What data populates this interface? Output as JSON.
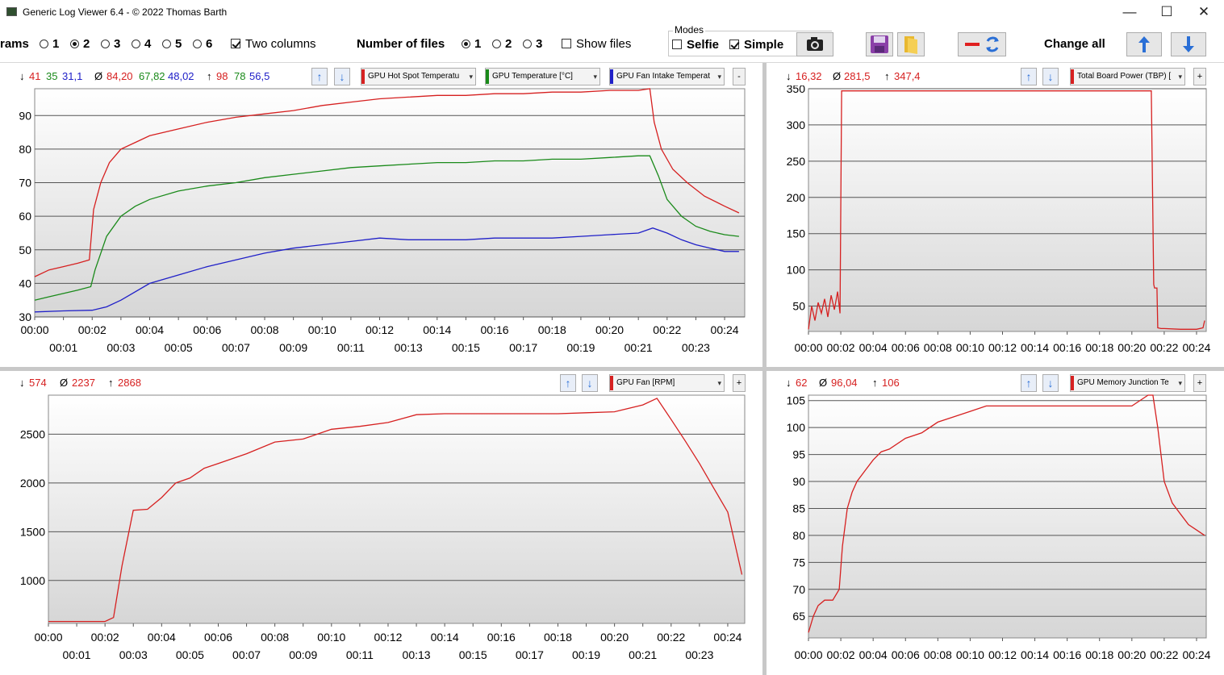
{
  "window": {
    "title": "Generic Log Viewer 6.4 - © 2022 Thomas Barth",
    "minimize": "—",
    "maximize": "☐",
    "close": "✕"
  },
  "toolbar": {
    "diagrams_label": "rams",
    "diagram_options": [
      "1",
      "2",
      "3",
      "4",
      "5",
      "6"
    ],
    "diagram_selected": "2",
    "two_columns_label": "Two columns",
    "two_columns_checked": true,
    "number_of_files_label": "Number of files",
    "file_options": [
      "1",
      "2",
      "3"
    ],
    "file_selected": "1",
    "show_files_label": "Show files",
    "show_files_checked": false,
    "modes_label": "Modes",
    "selfie_label": "Selfie",
    "selfie_checked": false,
    "simple_label": "Simple",
    "simple_checked": true,
    "change_all_label": "Change all",
    "icons": [
      "camera-icon",
      "save-icon",
      "folder-icon",
      "line-color-icon",
      "refresh-icon",
      "arrow-up-icon",
      "arrow-down-icon"
    ]
  },
  "panels": {
    "temps": {
      "min_values": [
        "41",
        "35",
        "31,1"
      ],
      "avg_values": [
        "84,20",
        "67,82",
        "48,02"
      ],
      "max_values": [
        "98",
        "78",
        "56,5"
      ],
      "stat_colors": [
        "#d62020",
        "#1a8a1a",
        "#2020c8"
      ],
      "selectors": [
        {
          "label": "GPU Hot Spot Temperatu",
          "color": "#d62020"
        },
        {
          "label": "GPU Temperature [°C]",
          "color": "#1a8a1a"
        },
        {
          "label": "GPU Fan Intake Temperat",
          "color": "#2020c8"
        }
      ],
      "extra_btn": "-"
    },
    "power": {
      "min_value": "16,32",
      "avg_value": "281,5",
      "max_value": "347,4",
      "selector": {
        "label": "Total Board Power (TBP) [",
        "color": "#d62020"
      },
      "extra_btn": "+"
    },
    "fan": {
      "min_value": "574",
      "avg_value": "2237",
      "max_value": "2868",
      "selector": {
        "label": "GPU Fan [RPM]",
        "color": "#d62020"
      },
      "extra_btn": "+"
    },
    "memjunc": {
      "min_value": "62",
      "avg_value": "96,04",
      "max_value": "106",
      "selector": {
        "label": "GPU Memory Junction Te",
        "color": "#d62020"
      },
      "extra_btn": "+"
    }
  },
  "symbols": {
    "min": "↓",
    "avg": "Ø",
    "max": "↑"
  },
  "chart_data": [
    {
      "id": "temps",
      "type": "line",
      "ylim": [
        30,
        98
      ],
      "yticks": [
        30,
        40,
        50,
        60,
        70,
        80,
        90
      ],
      "xticks_top": [
        "00:00",
        "00:02",
        "00:04",
        "00:06",
        "00:08",
        "00:10",
        "00:12",
        "00:14",
        "00:16",
        "00:18",
        "00:20",
        "00:22",
        "00:24"
      ],
      "xticks_bottom": [
        "00:01",
        "00:03",
        "00:05",
        "00:07",
        "00:09",
        "00:11",
        "00:13",
        "00:15",
        "00:17",
        "00:19",
        "00:21",
        "00:23"
      ],
      "xlim": [
        0,
        24.7
      ],
      "series": [
        {
          "color": "#d62020",
          "x": [
            0,
            0.5,
            1,
            1.5,
            1.9,
            2.05,
            2.3,
            2.6,
            3,
            3.5,
            4,
            5,
            6,
            7,
            8,
            9,
            10,
            11,
            12,
            13,
            14,
            15,
            16,
            17,
            18,
            19,
            20,
            21,
            21.4,
            21.55,
            21.8,
            22.2,
            22.7,
            23.3,
            24,
            24.5
          ],
          "y": [
            42,
            44,
            45,
            46,
            47,
            62,
            70,
            76,
            80,
            82,
            84,
            86,
            88,
            89.5,
            90.5,
            91.5,
            93,
            94,
            95,
            95.5,
            96,
            96,
            96.5,
            96.5,
            97,
            97,
            97.5,
            97.5,
            98,
            88,
            80,
            74,
            70,
            66,
            63,
            61
          ]
        },
        {
          "color": "#1a8a1a",
          "x": [
            0,
            0.5,
            1,
            1.5,
            1.95,
            2.1,
            2.5,
            3,
            3.5,
            4,
            5,
            6,
            7,
            8,
            9,
            10,
            11,
            12,
            13,
            14,
            15,
            16,
            17,
            18,
            19,
            20,
            21,
            21.4,
            21.7,
            22,
            22.5,
            23,
            23.5,
            24,
            24.5
          ],
          "y": [
            35,
            36,
            37,
            38,
            39,
            44,
            54,
            60,
            63,
            65,
            67.5,
            69,
            70,
            71.5,
            72.5,
            73.5,
            74.5,
            75,
            75.5,
            76,
            76,
            76.5,
            76.5,
            77,
            77,
            77.5,
            78,
            78,
            72,
            65,
            60,
            57,
            55.5,
            54.5,
            54
          ]
        },
        {
          "color": "#2020c8",
          "x": [
            0,
            1,
            2,
            2.5,
            3,
            4,
            5,
            6,
            7,
            8,
            9,
            10,
            11,
            12,
            13,
            14,
            15,
            16,
            17,
            18,
            19,
            20,
            21,
            21.5,
            22,
            22.5,
            23,
            23.5,
            24,
            24.5
          ],
          "y": [
            31.5,
            31.8,
            32,
            33,
            35,
            40,
            42.5,
            45,
            47,
            49,
            50.5,
            51.5,
            52.5,
            53.5,
            53,
            53,
            53,
            53.5,
            53.5,
            53.5,
            54,
            54.5,
            55,
            56.5,
            55,
            53,
            51.5,
            50.5,
            49.5,
            49.5
          ]
        }
      ]
    },
    {
      "id": "power",
      "type": "line",
      "ylim": [
        15,
        350
      ],
      "yticks": [
        50,
        100,
        150,
        200,
        250,
        300,
        350
      ],
      "xticks_top": [
        "00:00",
        "00:02",
        "00:04",
        "00:06",
        "00:08",
        "00:10",
        "00:12",
        "00:14",
        "00:16",
        "00:18",
        "00:20",
        "00:22",
        "00:24"
      ],
      "xlim": [
        0,
        24.6
      ],
      "series": [
        {
          "color": "#d62020",
          "x": [
            0,
            0.2,
            0.4,
            0.6,
            0.8,
            1.0,
            1.2,
            1.4,
            1.6,
            1.8,
            1.95,
            2.05,
            2.1,
            5,
            10,
            15,
            20,
            21.2,
            21.35,
            21.4,
            21.55,
            21.6,
            21.8,
            22,
            23,
            24,
            24.4,
            24.5
          ],
          "y": [
            18,
            50,
            30,
            55,
            40,
            60,
            35,
            65,
            45,
            70,
            40,
            347,
            347,
            347,
            347,
            347,
            347,
            347,
            80,
            75,
            75,
            20,
            19,
            19,
            18,
            18,
            20,
            30
          ]
        }
      ]
    },
    {
      "id": "fan",
      "type": "line",
      "ylim": [
        560,
        2900
      ],
      "yticks": [
        1000,
        1500,
        2000,
        2500
      ],
      "xticks_top": [
        "00:00",
        "00:02",
        "00:04",
        "00:06",
        "00:08",
        "00:10",
        "00:12",
        "00:14",
        "00:16",
        "00:18",
        "00:20",
        "00:22",
        "00:24"
      ],
      "xticks_bottom": [
        "00:01",
        "00:03",
        "00:05",
        "00:07",
        "00:09",
        "00:11",
        "00:13",
        "00:15",
        "00:17",
        "00:19",
        "00:21",
        "00:23"
      ],
      "xlim": [
        0,
        24.6
      ],
      "series": [
        {
          "color": "#d62020",
          "x": [
            0,
            1,
            2,
            2.3,
            2.6,
            3,
            3.5,
            4,
            4.5,
            5,
            5.5,
            6,
            7,
            8,
            9,
            10,
            11,
            12,
            13,
            14,
            15,
            16,
            17,
            18,
            19,
            20,
            21,
            21.5,
            22,
            22.5,
            23,
            23.5,
            24,
            24.5
          ],
          "y": [
            580,
            580,
            580,
            620,
            1150,
            1720,
            1730,
            1850,
            2000,
            2050,
            2150,
            2200,
            2300,
            2420,
            2450,
            2550,
            2580,
            2620,
            2700,
            2710,
            2710,
            2710,
            2710,
            2710,
            2720,
            2730,
            2800,
            2868,
            2650,
            2430,
            2200,
            1950,
            1700,
            1060
          ]
        }
      ]
    },
    {
      "id": "memjunc",
      "type": "line",
      "ylim": [
        61,
        106
      ],
      "yticks": [
        65,
        70,
        75,
        80,
        85,
        90,
        95,
        100,
        105
      ],
      "xticks_top": [
        "00:00",
        "00:02",
        "00:04",
        "00:06",
        "00:08",
        "00:10",
        "00:12",
        "00:14",
        "00:16",
        "00:18",
        "00:20",
        "00:22",
        "00:24"
      ],
      "xlim": [
        0,
        24.6
      ],
      "series": [
        {
          "color": "#d62020",
          "x": [
            0,
            0.3,
            0.6,
            1.0,
            1.5,
            1.9,
            2.1,
            2.4,
            2.7,
            3.0,
            3.5,
            4,
            4.5,
            5,
            6,
            7,
            8,
            9,
            10,
            11,
            12,
            13,
            14,
            15,
            16,
            17,
            18,
            19,
            20,
            21,
            21.3,
            21.6,
            22,
            22.5,
            23,
            23.5,
            24,
            24.5
          ],
          "y": [
            62,
            65,
            67,
            68,
            68,
            70,
            78,
            85,
            88,
            90,
            92,
            94,
            95.5,
            96,
            98,
            99,
            101,
            102,
            103,
            104,
            104,
            104,
            104,
            104,
            104,
            104,
            104,
            104,
            104,
            106,
            106,
            100,
            90,
            86,
            84,
            82,
            81,
            80
          ]
        }
      ]
    }
  ]
}
